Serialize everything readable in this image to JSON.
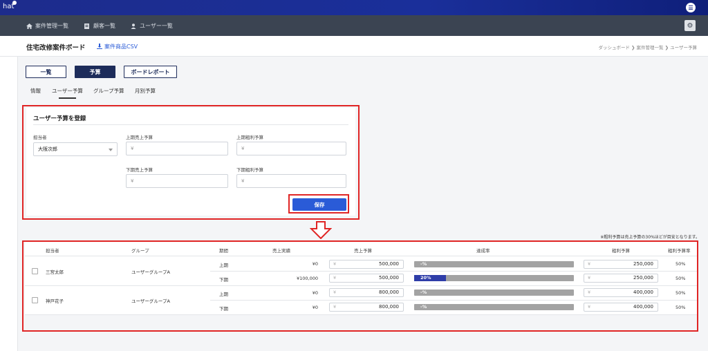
{
  "app": {
    "logo": "hat"
  },
  "nav": [
    {
      "label": "案件管理一覧",
      "icon": "home-icon"
    },
    {
      "label": "顧客一覧",
      "icon": "document-icon"
    },
    {
      "label": "ユーザー一覧",
      "icon": "user-icon"
    }
  ],
  "header": {
    "title": "住宅改修案件ボード",
    "csv_label": "案件商品CSV",
    "breadcrumb": "ダッシュボード ❯ 案件管理一覧 ❯ ユーザー予算"
  },
  "views": [
    {
      "label": "一覧",
      "active": false
    },
    {
      "label": "予算",
      "active": true
    },
    {
      "label": "ボードレポート",
      "active": false
    }
  ],
  "subtabs": [
    {
      "label": "情報",
      "active": false
    },
    {
      "label": "ユーザー予算",
      "active": true
    },
    {
      "label": "グループ予算",
      "active": false
    },
    {
      "label": "月別予算",
      "active": false
    }
  ],
  "form": {
    "title": "ユーザー予算を登録",
    "owner_label": "担当者",
    "owner_value": "大阪次郎",
    "first_sales_label": "上期売上予算",
    "first_profit_label": "上期粗利予算",
    "second_sales_label": "下期売上予算",
    "second_profit_label": "下期粗利予算",
    "yen_placeholder": "¥",
    "save_label": "保存"
  },
  "note": "※粗利予算は売上予算の30%ほどが目安となります。",
  "table": {
    "headers": {
      "owner": "担当者",
      "group": "グループ",
      "period": "期間",
      "actual": "売上実績",
      "sales_budget": "売上予算",
      "achievement": "達成率",
      "profit_budget": "粗利予算",
      "profit_rate": "粗利予算率"
    },
    "yen": "¥",
    "users": [
      {
        "name": "三宮太郎",
        "group": "ユーザーグループA",
        "rows": [
          {
            "period": "上期",
            "actual": "¥0",
            "sales": "500,000",
            "achievement": "-%",
            "achievement_ratio": 0,
            "profit": "250,000",
            "rate": "50%"
          },
          {
            "period": "下期",
            "actual": "¥100,000",
            "sales": "500,000",
            "achievement": "20%",
            "achievement_ratio": 0.2,
            "profit": "250,000",
            "rate": "50%"
          }
        ]
      },
      {
        "name": "神戸花子",
        "group": "ユーザーグループA",
        "rows": [
          {
            "period": "上期",
            "actual": "¥0",
            "sales": "800,000",
            "achievement": "-%",
            "achievement_ratio": 0,
            "profit": "400,000",
            "rate": "50%"
          },
          {
            "period": "下期",
            "actual": "¥0",
            "sales": "800,000",
            "achievement": "-%",
            "achievement_ratio": 0,
            "profit": "400,000",
            "rate": "50%"
          }
        ]
      }
    ]
  },
  "colors": {
    "accent": "#2a5bd7",
    "navy": "#1d2c5a",
    "highlight": "#e02424",
    "progress": "#2e3da8"
  }
}
